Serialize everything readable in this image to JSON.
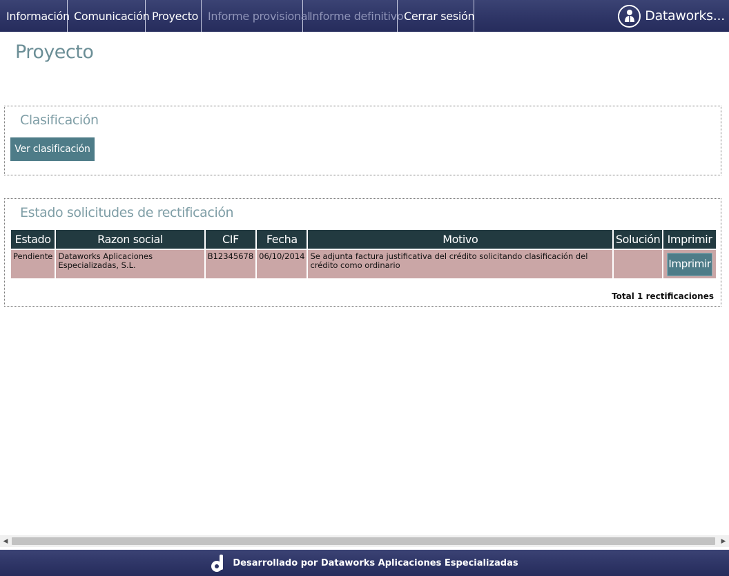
{
  "nav": {
    "items": [
      {
        "label": "Información"
      },
      {
        "label": "Comunicación"
      },
      {
        "label": "Proyecto"
      },
      {
        "label": "Informe provisional"
      },
      {
        "label": "Informe definitivo"
      },
      {
        "label": "Cerrar sesión"
      }
    ],
    "user_label": "Dataworks..."
  },
  "page": {
    "title": "Proyecto"
  },
  "clasificacion": {
    "legend": "Clasificación",
    "button_label": "Ver clasificación"
  },
  "rectificacion": {
    "legend": "Estado solicitudes de rectificación",
    "columns": [
      "Estado",
      "Razon social",
      "CIF",
      "Fecha",
      "Motivo",
      "Solución",
      "Imprimir"
    ],
    "rows": [
      {
        "estado": "Pendiente",
        "razon_social": "Dataworks Aplicaciones Especializadas, S.L.",
        "cif": "B12345678",
        "fecha": "06/10/2014",
        "motivo": "Se adjunta factura justificativa del crédito solicitando clasificación del crédito como ordinario",
        "solucion": "",
        "print_label": "Imprimir"
      }
    ],
    "total": "Total 1 rectificaciones"
  },
  "footer": {
    "text": "Desarrollado por Dataworks Aplicaciones Especializadas"
  },
  "colors": {
    "nav_bg": "#2e3566",
    "button": "#4e7c88",
    "table_header": "#223a40",
    "row_pending": "#caa6a6",
    "title": "#6b8e96"
  }
}
